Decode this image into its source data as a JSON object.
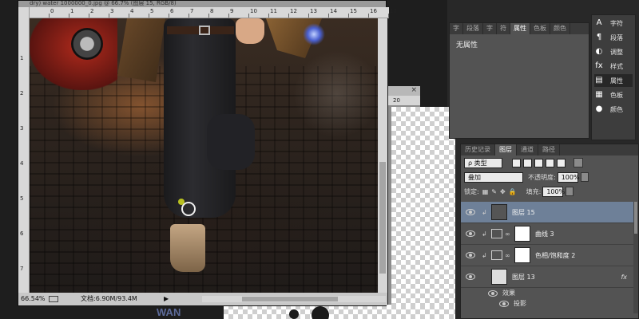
{
  "document": {
    "title_fragment": "dry) water 1000000_0.jpg @ 66.7% (图层 15, RGB/8)",
    "ruler_top_ticks": [
      "0",
      "1",
      "2",
      "3",
      "4",
      "5",
      "6",
      "7",
      "8",
      "9",
      "10",
      "11",
      "12",
      "13",
      "14",
      "15",
      "16",
      "17"
    ],
    "ruler_left_ticks": [
      "1",
      "2",
      "3",
      "4",
      "5",
      "6",
      "7"
    ],
    "status_zoom": "66.54%",
    "status_doc": "文档:6.90M/93.4M",
    "status_arrow": "▶"
  },
  "background_doc": {
    "ruler_label": "20",
    "close": "×",
    "text_fragment": "WAN"
  },
  "properties_panel": {
    "tabs": [
      "字",
      "段落",
      "字",
      "符",
      "属性",
      "色板",
      "颜色"
    ],
    "active_tab": "属性",
    "body_text": "无属性"
  },
  "side_panel": {
    "items": [
      {
        "label": "字符",
        "icon": "A"
      },
      {
        "label": "段落",
        "icon": "¶"
      },
      {
        "label": "调整",
        "icon": "◐"
      },
      {
        "label": "样式",
        "icon": "fx"
      },
      {
        "label": "属性",
        "icon": "▤"
      },
      {
        "label": "色板",
        "icon": "▦"
      },
      {
        "label": "颜色",
        "icon": "●"
      }
    ],
    "active_label": "属性"
  },
  "layers_panel": {
    "tabs": [
      "历史记录",
      "图层",
      "通道",
      "路径"
    ],
    "active_tab": "图层",
    "filter_label": "ρ 类型",
    "blend_mode": "叠加",
    "opacity_label": "不透明度:",
    "opacity_value": "100%",
    "lock_label": "锁定:",
    "fill_label": "填充:",
    "fill_value": "100%",
    "layers": [
      {
        "name": "图层 15",
        "selected": true,
        "clipped": true,
        "kind": "pixel"
      },
      {
        "name": "曲线 3",
        "selected": false,
        "clipped": true,
        "kind": "adjustment"
      },
      {
        "name": "色相/饱和度 2",
        "selected": false,
        "clipped": true,
        "kind": "adjustment"
      },
      {
        "name": "图层 13",
        "selected": false,
        "clipped": false,
        "kind": "pixel",
        "fx": "fx"
      }
    ],
    "effects_label": "效果",
    "effect_item": "投影"
  },
  "colors": {
    "selected_layer": "#6e8098",
    "panel_bg": "#535353",
    "brush_pin": "#b8c020"
  }
}
